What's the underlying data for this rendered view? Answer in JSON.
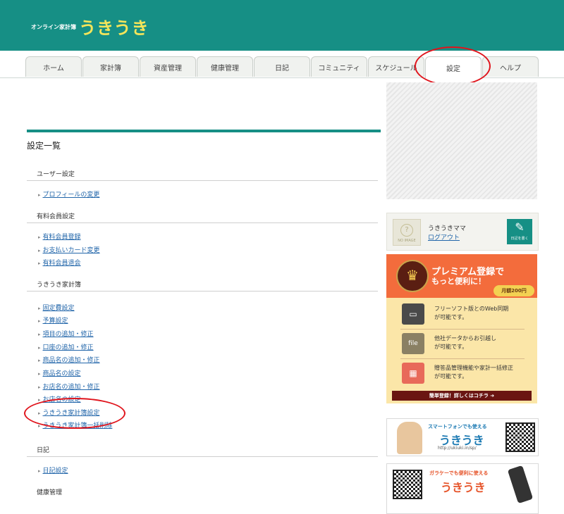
{
  "header": {
    "sub": "オンライン家計簿",
    "logo": "うきうき"
  },
  "nav": [
    "ホーム",
    "家計簿",
    "資産管理",
    "健康管理",
    "日記",
    "コミュニティ",
    "スケジュール",
    "設定",
    "ヘルプ"
  ],
  "page_title": "設定一覧",
  "sections": [
    {
      "title": "ユーザー設定",
      "links": [
        "プロフィールの変更"
      ]
    },
    {
      "title": "有料会員設定",
      "links": [
        "有料会員登録",
        "お支払いカード変更",
        "有料会員退会"
      ]
    },
    {
      "title": "うきうき家計簿",
      "links": [
        "固定費設定",
        "予算設定",
        "項目の追加・修正",
        "口座の追加・修正",
        "商品名の追加・修正",
        "商品名の設定",
        "お店名の追加・修正",
        "お店名の設定",
        "うきうき家計簿設定",
        "うきうき家計簿一括削除"
      ]
    },
    {
      "title": "日記",
      "links": [
        "日記設定"
      ]
    },
    {
      "title": "健康管理",
      "links": []
    }
  ],
  "profile": {
    "noimage": "NO IMAGE",
    "name": "うきうきママ",
    "logout": "ログアウト",
    "diary_btn": "日記を書く"
  },
  "premium": {
    "title1": "プレミアム登録で",
    "title2": "もっと便利に！",
    "price": "月額200円",
    "features": [
      {
        "line1": "フリーソフト版とのWeb同期",
        "line2": "が可能です。"
      },
      {
        "line1": "他社データからお引越し",
        "line2": "が可能です。"
      },
      {
        "line1": "贈答品管理機能や家計一括修正",
        "line2": "が可能です。"
      }
    ],
    "cta": "簡単登録！詳しくはコチラ"
  },
  "smartphone_ad": {
    "line1": "スマートフォンでも使える",
    "logo": "うきうき",
    "url": "http://ukiuki.in/sp/"
  },
  "garake_ad": {
    "line1": "ガラケーでも便利に使える",
    "logo": "うきうき"
  },
  "colors": {
    "teal": "#168f85",
    "logo_yellow": "#f4e55a",
    "link_blue": "#2266aa",
    "highlight_red": "#e0141c",
    "premium_orange": "#f36c3c"
  }
}
